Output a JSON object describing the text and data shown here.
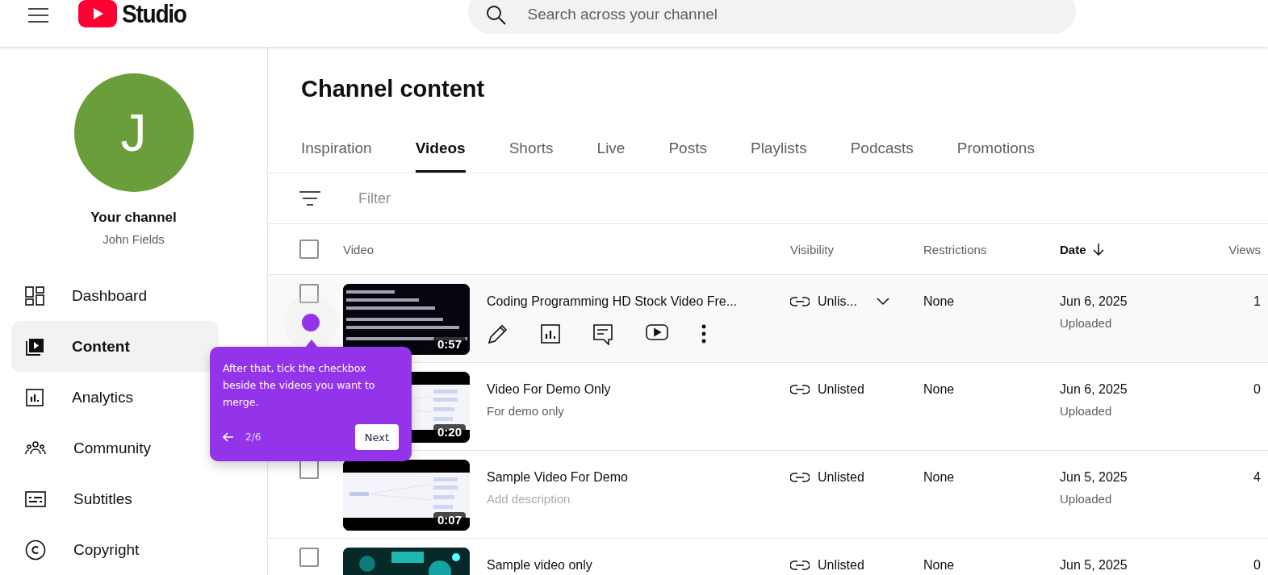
{
  "header": {
    "logo_text": "Studio",
    "search": {
      "placeholder": "Search across your channel"
    }
  },
  "sidebar": {
    "avatar_letter": "J",
    "channel_label": "Your channel",
    "channel_name": "John Fields",
    "items": [
      {
        "label": "Dashboard",
        "selected": false
      },
      {
        "label": "Content",
        "selected": true
      },
      {
        "label": "Analytics",
        "selected": false
      },
      {
        "label": "Community",
        "selected": false
      },
      {
        "label": "Subtitles",
        "selected": false
      },
      {
        "label": "Copyright",
        "selected": false
      }
    ]
  },
  "page_title": "Channel content",
  "tabs": [
    {
      "label": "Inspiration",
      "selected": false
    },
    {
      "label": "Videos",
      "selected": true
    },
    {
      "label": "Shorts",
      "selected": false
    },
    {
      "label": "Live",
      "selected": false
    },
    {
      "label": "Posts",
      "selected": false
    },
    {
      "label": "Playlists",
      "selected": false
    },
    {
      "label": "Podcasts",
      "selected": false
    },
    {
      "label": "Promotions",
      "selected": false
    }
  ],
  "filter": {
    "placeholder": "Filter"
  },
  "table": {
    "select_all_checked": false,
    "columns": [
      {
        "label": "Video",
        "sorted": false
      },
      {
        "label": "Visibility",
        "sorted": false
      },
      {
        "label": "Restrictions",
        "sorted": false
      },
      {
        "label": "Date",
        "sorted": true
      },
      {
        "label": "Views",
        "sorted": false
      }
    ],
    "rows": [
      {
        "title": "Coding Programming HD Stock Video Fre...",
        "duration": "0:57",
        "hovered": true,
        "checked": false,
        "visibility": "Unlis...",
        "restrictions": "None",
        "date": "Jun 6, 2025",
        "date_status": "Uploaded",
        "views": "1"
      },
      {
        "title": "Video For Demo Only",
        "description": "For demo only",
        "duration": "0:20",
        "hovered": false,
        "visibility": "Unlisted",
        "restrictions": "None",
        "date": "Jun 6, 2025",
        "date_status": "Uploaded",
        "views": "0"
      },
      {
        "title": "Sample Video For Demo",
        "description": "Add description",
        "description_placeholder": true,
        "duration": "0:07",
        "hovered": false,
        "checked": false,
        "visibility": "Unlisted",
        "restrictions": "None",
        "date": "Jun 5, 2025",
        "date_status": "Uploaded",
        "views": "4"
      },
      {
        "title": "Sample video only",
        "hovered": false,
        "checked": false,
        "visibility": "Unlisted",
        "restrictions": "None",
        "date": "Jun 5, 2025",
        "views": "0"
      }
    ]
  },
  "tour": {
    "text": "After that, tick the checkbox beside the videos you want to merge.",
    "step": "2/6",
    "next": "Next"
  }
}
